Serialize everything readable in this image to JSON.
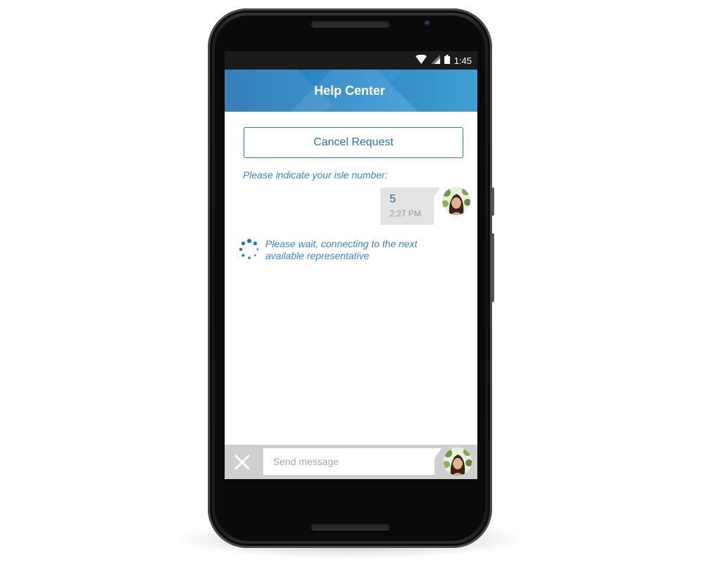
{
  "status_bar": {
    "time": "1:45",
    "icons": [
      "wifi-icon",
      "cell-signal-icon",
      "battery-icon"
    ]
  },
  "header": {
    "title": "Help Center"
  },
  "chat": {
    "cancel_label": "Cancel Request",
    "prompt": "Please indicate your isle number:",
    "messages": [
      {
        "sender": "user",
        "text": "5",
        "time": "2:27 PM"
      }
    ],
    "wait_text": "Please wait, connecting to the next available representative"
  },
  "composer": {
    "placeholder": "Send message",
    "value": ""
  },
  "colors": {
    "accent": "#2b73ad",
    "text_blue": "#3a86c0",
    "bubble_bg": "#e3e3e3",
    "input_bar_bg": "#cfcfcf"
  }
}
